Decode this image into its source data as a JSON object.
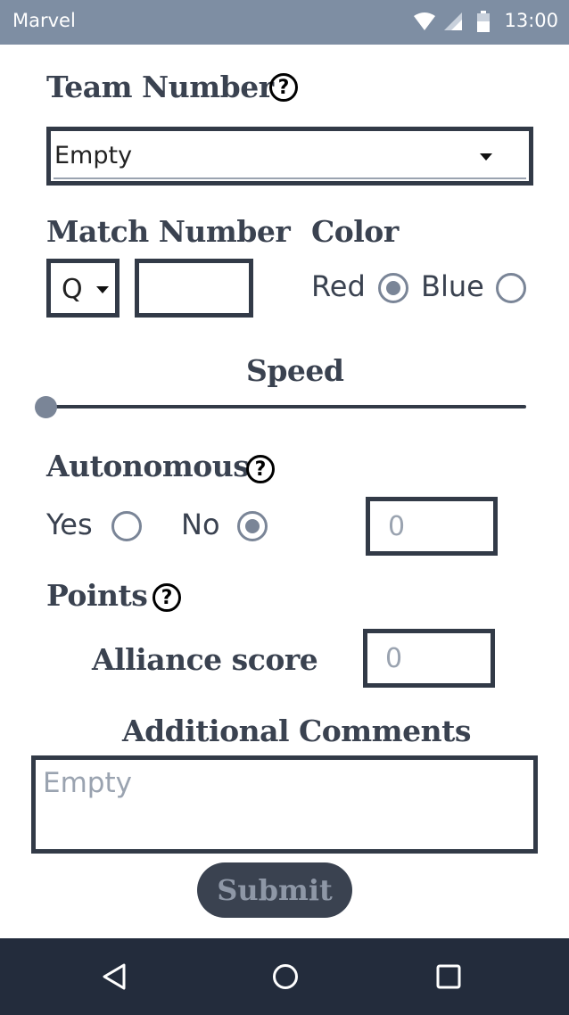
{
  "status_bar": {
    "app_name": "Marvel",
    "time": "13:00"
  },
  "team": {
    "heading": "Team Number",
    "select_value": "Empty"
  },
  "match": {
    "heading": "Match Number",
    "type_value": "Q",
    "number_value": ""
  },
  "color": {
    "heading": "Color",
    "red_label": "Red",
    "blue_label": "Blue",
    "selected": "Red"
  },
  "speed": {
    "heading": "Speed",
    "value_fraction": 0
  },
  "autonomous": {
    "heading": "Autonomous",
    "yes_label": "Yes",
    "no_label": "No",
    "selected": "No",
    "count_placeholder": "0"
  },
  "points": {
    "heading": "Points",
    "alliance_label": "Alliance score",
    "alliance_placeholder": "0"
  },
  "comments": {
    "heading": "Additional Comments",
    "placeholder": "Empty"
  },
  "submit_label": "Submit",
  "colors": {
    "status_bar": "#7e8ea3",
    "nav_bar": "#232c3c",
    "text": "#3a4250",
    "border": "#323a47"
  }
}
